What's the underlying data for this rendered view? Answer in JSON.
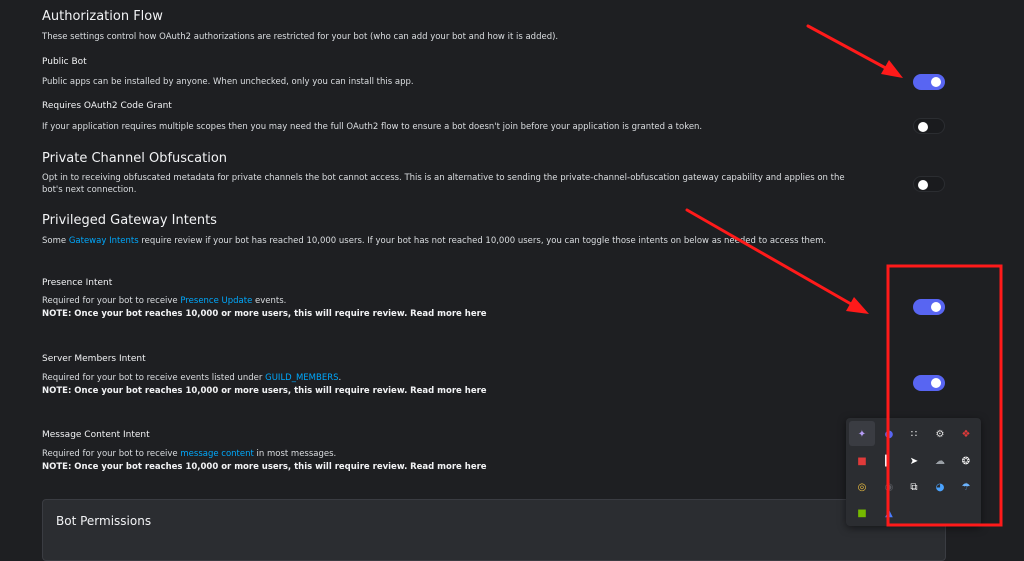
{
  "auth": {
    "title": "Authorization Flow",
    "desc": "These settings control how OAuth2 authorizations are restricted for your bot (who can add your bot and how it is added)."
  },
  "public_bot": {
    "label": "Public Bot",
    "desc": "Public apps can be installed by anyone. When unchecked, only you can install this app.",
    "enabled": true
  },
  "oauth_grant": {
    "label": "Requires OAuth2 Code Grant",
    "desc": "If your application requires multiple scopes then you may need the full OAuth2 flow to ensure a bot doesn't join before your application is granted a token.",
    "enabled": false
  },
  "obfuscation": {
    "title": "Private Channel Obfuscation",
    "desc_line1": "Opt in to receiving obfuscated metadata for private channels the bot cannot access. This is an alternative to sending the private-channel-obfuscation gateway capability and applies on the",
    "desc_line2": "bot's next connection.",
    "enabled": false
  },
  "intents": {
    "title": "Privileged Gateway Intents",
    "desc_pre": "Some ",
    "desc_link": "Gateway Intents",
    "desc_post": " require review if your bot has reached 10,000 users. If your bot has not reached 10,000 users, you can toggle those intents on below as needed to access them."
  },
  "presence": {
    "label": "Presence Intent",
    "desc_pre": "Required for your bot to receive ",
    "desc_link": "Presence Update",
    "desc_post": " events.",
    "note": "NOTE: Once your bot reaches 10,000 or more users, this will require review.",
    "read_more": "Read more here",
    "enabled": true
  },
  "members": {
    "label": "Server Members Intent",
    "desc_pre": "Required for your bot to receive events listed under ",
    "desc_link": "GUILD_MEMBERS",
    "desc_post": ".",
    "note": "NOTE: Once your bot reaches 10,000 or more users, this will require review.",
    "read_more": "Read more here",
    "enabled": true
  },
  "message_content": {
    "label": "Message Content Intent",
    "desc_pre": "Required for your bot to receive ",
    "desc_link": "message content",
    "desc_post": " in most messages.",
    "note": "NOTE: Once your bot reaches 10,000 or more users, this will require review.",
    "read_more": "Read more here"
  },
  "bot_permissions": {
    "title": "Bot Permissions"
  },
  "colors": {
    "background": "#1e1f22",
    "toggle_on": "#5865f2",
    "link": "#00a8fc",
    "annotation": "#ff1a1a"
  },
  "tray_icons": [
    "feather-icon",
    "discord-icon",
    "grid-icon",
    "gear-icon",
    "shield-icon",
    "app-red-icon",
    "bar-icon",
    "telegram-icon",
    "cloud-icon",
    "steam-ring-icon",
    "overwolf-icon",
    "shadow-icon",
    "layers-icon",
    "globe-icon",
    "steam-icon",
    "nvidia-icon",
    "bluetooth-icon"
  ]
}
